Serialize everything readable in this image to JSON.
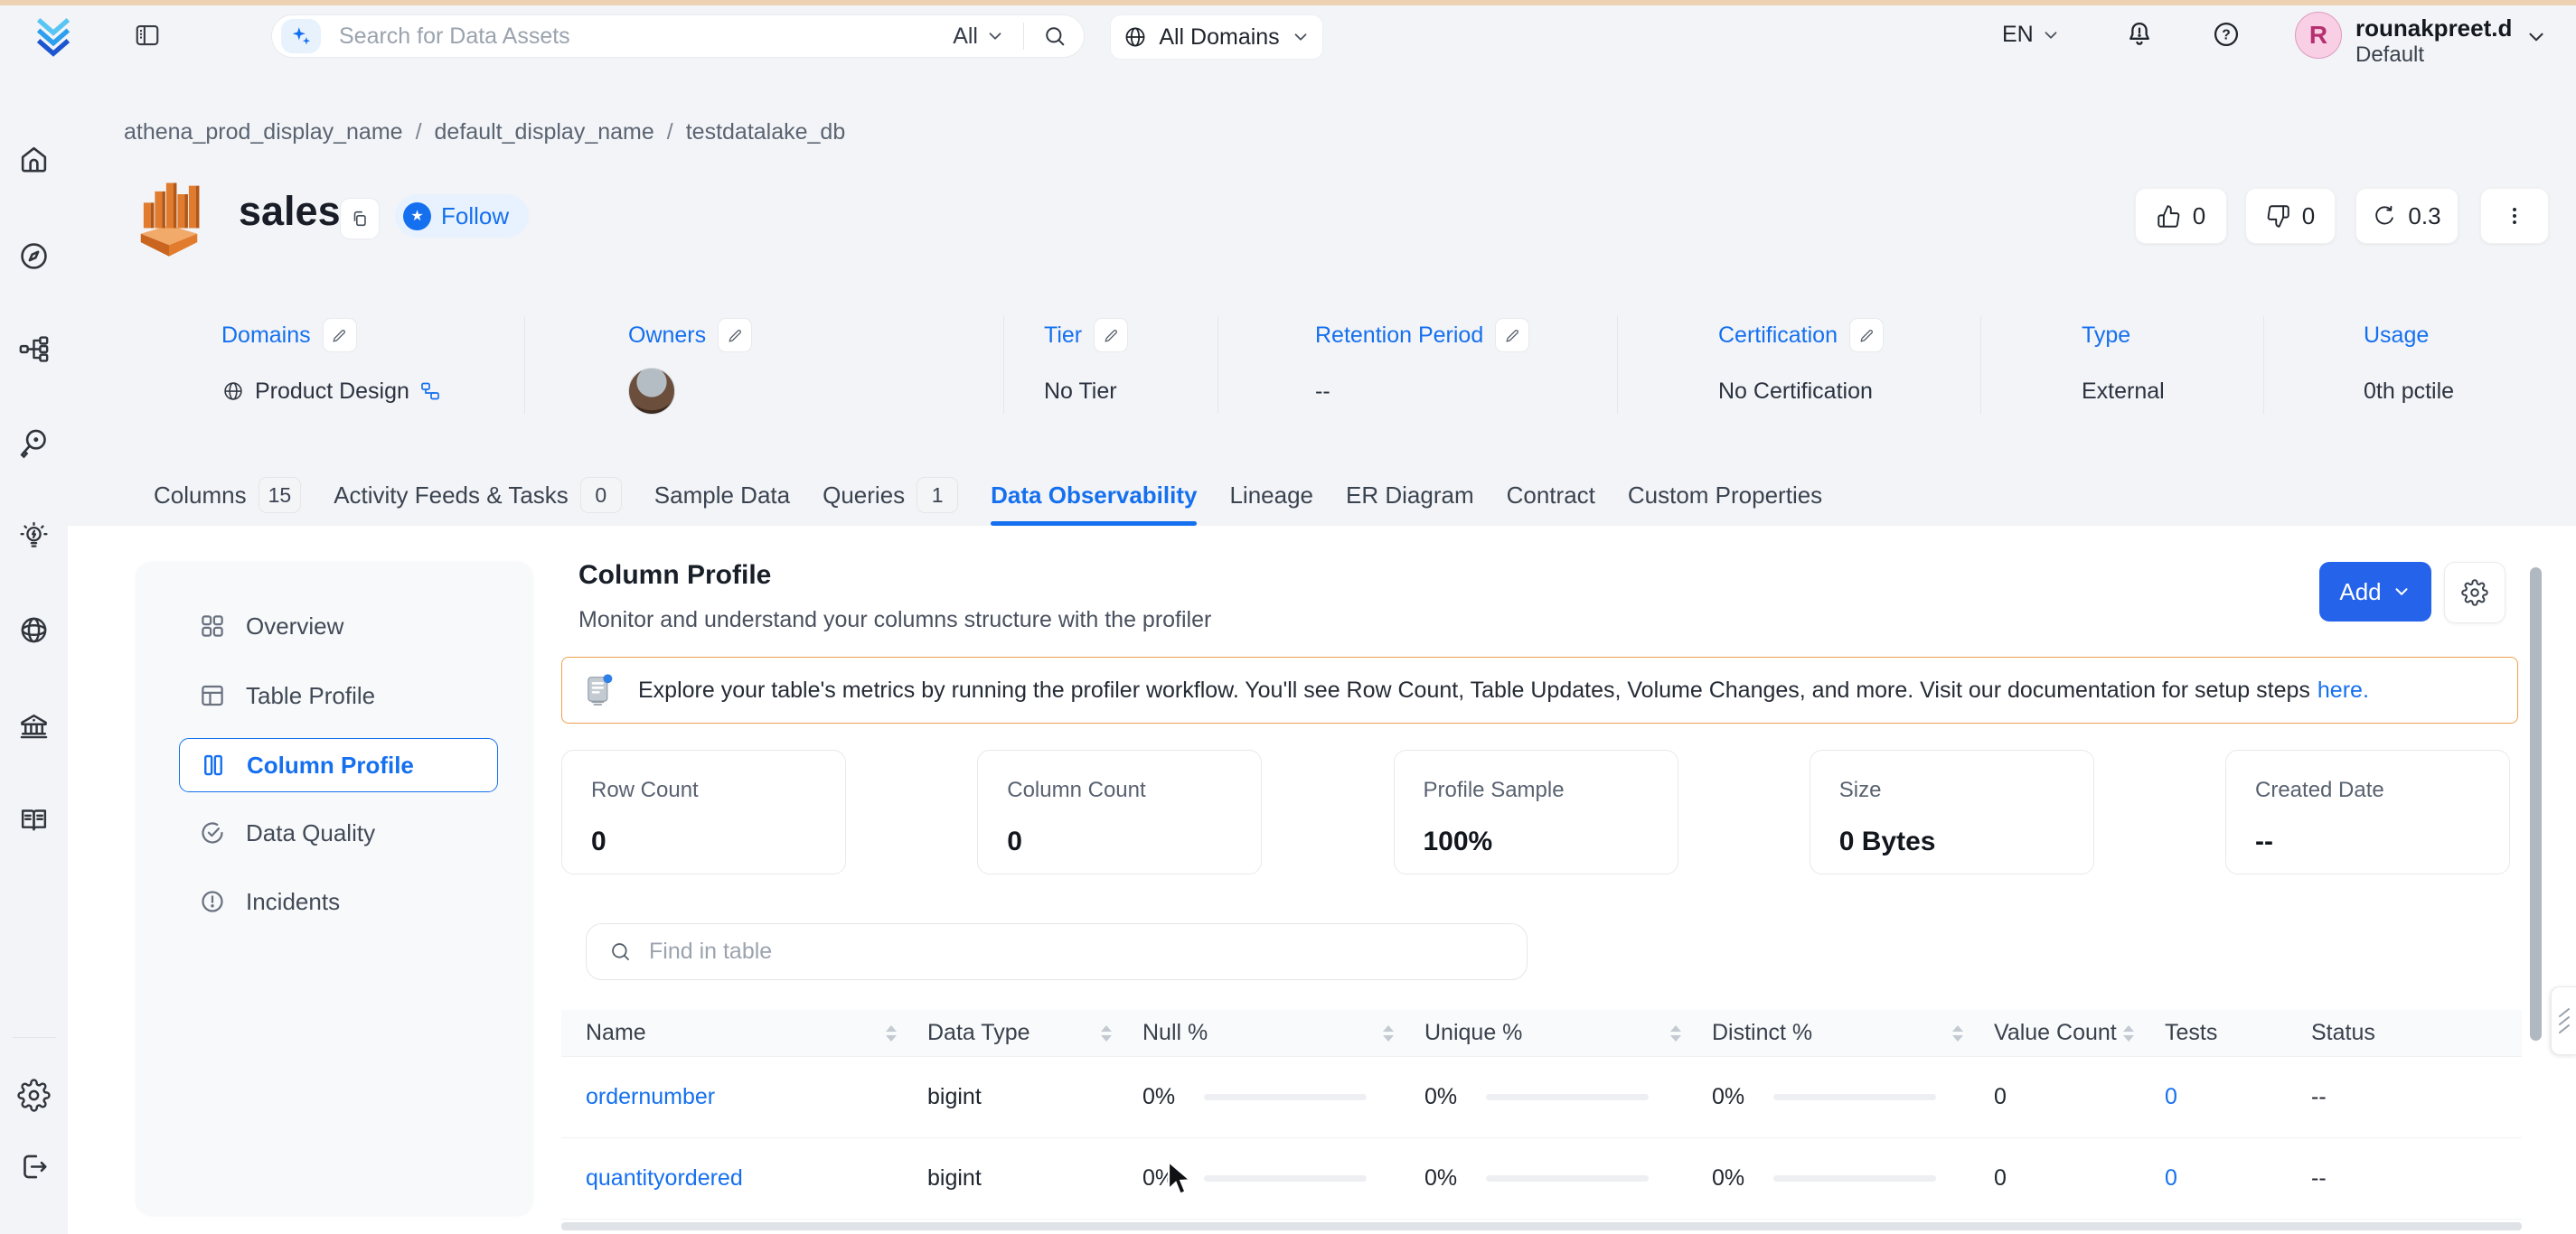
{
  "header": {
    "search_placeholder": "Search for Data Assets",
    "search_scope_label": "All",
    "domains_label": "All Domains",
    "language": "EN",
    "user": {
      "initial": "R",
      "name": "rounakpreet.d",
      "team": "Default"
    }
  },
  "breadcrumb": {
    "separator": "/",
    "items": [
      "athena_prod_display_name",
      "default_display_name",
      "testdatalake_db"
    ]
  },
  "entity": {
    "title": "sales",
    "follow_label": "Follow",
    "upvotes": "0",
    "downvotes": "0",
    "version": "0.3"
  },
  "metadata": {
    "columns": [
      {
        "label": "Domains",
        "value": "Product Design"
      },
      {
        "label": "Owners",
        "value": ""
      },
      {
        "label": "Tier",
        "value": "No Tier"
      },
      {
        "label": "Retention Period",
        "value": "--"
      },
      {
        "label": "Certification",
        "value": "No Certification"
      },
      {
        "label": "Type",
        "value": "External"
      },
      {
        "label": "Usage",
        "value": "0th pctile"
      }
    ]
  },
  "tabs": [
    {
      "label": "Columns",
      "badge": "15"
    },
    {
      "label": "Activity Feeds & Tasks",
      "badge": "0"
    },
    {
      "label": "Sample Data"
    },
    {
      "label": "Queries",
      "badge": "1"
    },
    {
      "label": "Data Observability"
    },
    {
      "label": "Lineage"
    },
    {
      "label": "ER Diagram"
    },
    {
      "label": "Contract"
    },
    {
      "label": "Custom Properties"
    }
  ],
  "profiler_nav": [
    {
      "label": "Overview"
    },
    {
      "label": "Table Profile"
    },
    {
      "label": "Column Profile"
    },
    {
      "label": "Data Quality"
    },
    {
      "label": "Incidents"
    }
  ],
  "main": {
    "title": "Column Profile",
    "subtitle": "Monitor and understand your columns structure with the profiler",
    "add_label": "Add",
    "banner": {
      "text": "Explore your table's metrics by running the profiler workflow. You'll see Row Count, Table Updates, Volume Changes, and more. Visit our documentation for setup steps",
      "link_label": "here."
    },
    "stats": [
      {
        "label": "Row Count",
        "value": "0"
      },
      {
        "label": "Column Count",
        "value": "0"
      },
      {
        "label": "Profile Sample",
        "value": "100%"
      },
      {
        "label": "Size",
        "value": "0 Bytes"
      },
      {
        "label": "Created Date",
        "value": "--"
      }
    ],
    "find_placeholder": "Find in table",
    "table": {
      "columns": [
        {
          "label": "Name"
        },
        {
          "label": "Data Type"
        },
        {
          "label": "Null %"
        },
        {
          "label": "Unique %"
        },
        {
          "label": "Distinct %"
        },
        {
          "label": "Value Count"
        },
        {
          "label": "Tests"
        },
        {
          "label": "Status"
        }
      ],
      "rows": [
        {
          "name": "ordernumber",
          "data_type": "bigint",
          "null_pct": "0%",
          "unique_pct": "0%",
          "distinct_pct": "0%",
          "value_count": "0",
          "tests": "0",
          "status": "--"
        },
        {
          "name": "quantityordered",
          "data_type": "bigint",
          "null_pct": "0%",
          "unique_pct": "0%",
          "distinct_pct": "0%",
          "value_count": "0",
          "tests": "0",
          "status": "--"
        }
      ]
    }
  },
  "glyphs": {
    "follow_star": "★",
    "help": "?"
  },
  "colors": {
    "accent": "#1570ef",
    "add_button": "#2563eb",
    "banner_border": "#eda14e",
    "top_strip": "#ecd2b2",
    "avatar_bg": "#f9cfe6",
    "avatar_text": "#b5306f",
    "athena_orange": "#e17b2d"
  }
}
